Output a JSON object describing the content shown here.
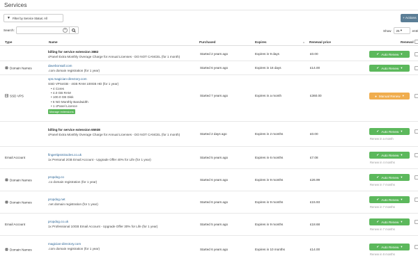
{
  "page": {
    "title": "Services",
    "filter_label": "Filter by Service Status: All",
    "action_label": "+ Actions",
    "search_label": "Search:",
    "search_placeholder": "",
    "show_label": "Show",
    "show_value": "25",
    "entries_label": "entries"
  },
  "columns": {
    "type": "Type",
    "name": "Name",
    "purchased": "Purchased",
    "expires": "Expires",
    "renewal_price": "Renewal price",
    "renewal": "Renewal"
  },
  "rows": [
    {
      "type": "",
      "icon": "",
      "title": "billing for service extension 3882",
      "link": "",
      "desc": "cPanel Extra Monthly Overage Charge for Annual Licenses - DO NOT CANCEL (for 1 month)",
      "purchased": "Started 2 years ago",
      "expires": "Expires in 9 days",
      "price": "£0.00",
      "renewal": "Auto Renew",
      "renewal_style": "auto",
      "note": ""
    },
    {
      "type": "Domain Names",
      "icon": "globe-icon",
      "title": "",
      "link": "davebonsall.com",
      "desc": ".com domain registration (for 1 year)",
      "purchased": "Started 6 years ago",
      "expires": "Expires in 16 days",
      "price": "£14.00",
      "renewal": "Auto Renew",
      "renewal_style": "auto",
      "note": ""
    },
    {
      "type": "SSD VPS",
      "icon": "server-icon",
      "title": "",
      "link": "vps.magician-directory.com",
      "desc": "SSD VPS4GB - 4GB RAM 100GB HD (for 1 year)",
      "specs": [
        "4 Cores",
        "4.0 GB RAM",
        "100.0 GB Disk",
        "6 NO Monthly Bandwidth",
        "1 cPanel Licence"
      ],
      "manage_label": "Manage extensions",
      "purchased": "Started 7 years ago",
      "expires": "Expires in a month",
      "price": "£360.00",
      "renewal": "Manual Renew",
      "renewal_style": "manual",
      "note": ""
    },
    {
      "type": "",
      "icon": "",
      "title": "billing for service extension 65938",
      "link": "",
      "desc": "cPanel Extra Monthly Overage Charge for Annual Licenses - DO NOT CANCEL (for 1 month)",
      "purchased": "Started 2 days ago",
      "expires": "Expires in 2 months",
      "price": "£0.00",
      "renewal": "Auto Renew",
      "renewal_style": "auto",
      "note": "Renew in a month"
    },
    {
      "type": "Email Account",
      "icon": "",
      "title": "",
      "link": "fingertipsmiracles.co.uk",
      "desc": "1x Personal 2GB Email Account - Upgrade Offer 40% for Life (for 1 year)",
      "purchased": "Started 5 years ago",
      "expires": "Expires in 6 months",
      "price": "£7.08",
      "renewal": "Auto Renew",
      "renewal_style": "auto",
      "note": "Renew in 4 months"
    },
    {
      "type": "Domain Names",
      "icon": "globe-icon",
      "title": "",
      "link": "propdog.co",
      "desc": ".co domain registration (for 1 year)",
      "purchased": "Started 6 years ago",
      "expires": "Expires in 9 months",
      "price": "£26.99",
      "renewal": "Auto Renew",
      "renewal_style": "auto",
      "note": "Renew in 7 months"
    },
    {
      "type": "Domain Names",
      "icon": "globe-icon",
      "title": "",
      "link": "propdog.net",
      "desc": ".net domain registration (for 1 year)",
      "purchased": "Started 6 years ago",
      "expires": "Expires in 9 months",
      "price": "£15.93",
      "renewal": "Auto Renew",
      "renewal_style": "auto",
      "note": "Renew in 7 months"
    },
    {
      "type": "Email Account",
      "icon": "",
      "title": "",
      "link": "propdog.co.uk",
      "desc": "1x Professional 10GB Email Account - Upgrade Offer 30% for Life (for 1 year)",
      "purchased": "Started 5 years ago",
      "expires": "Expires in 9 months",
      "price": "£18.68",
      "renewal": "Auto Renew",
      "renewal_style": "auto",
      "note": "Renew in 7 months"
    },
    {
      "type": "Domain Names",
      "icon": "globe-icon",
      "title": "",
      "link": "magician-directory.com",
      "desc": ".com domain registration (for 1 year)",
      "purchased": "Started 6 years ago",
      "expires": "Expires in 10 months",
      "price": "£14.00",
      "renewal": "Auto Renew",
      "renewal_style": "auto",
      "note": "Renew in 8 months"
    }
  ]
}
